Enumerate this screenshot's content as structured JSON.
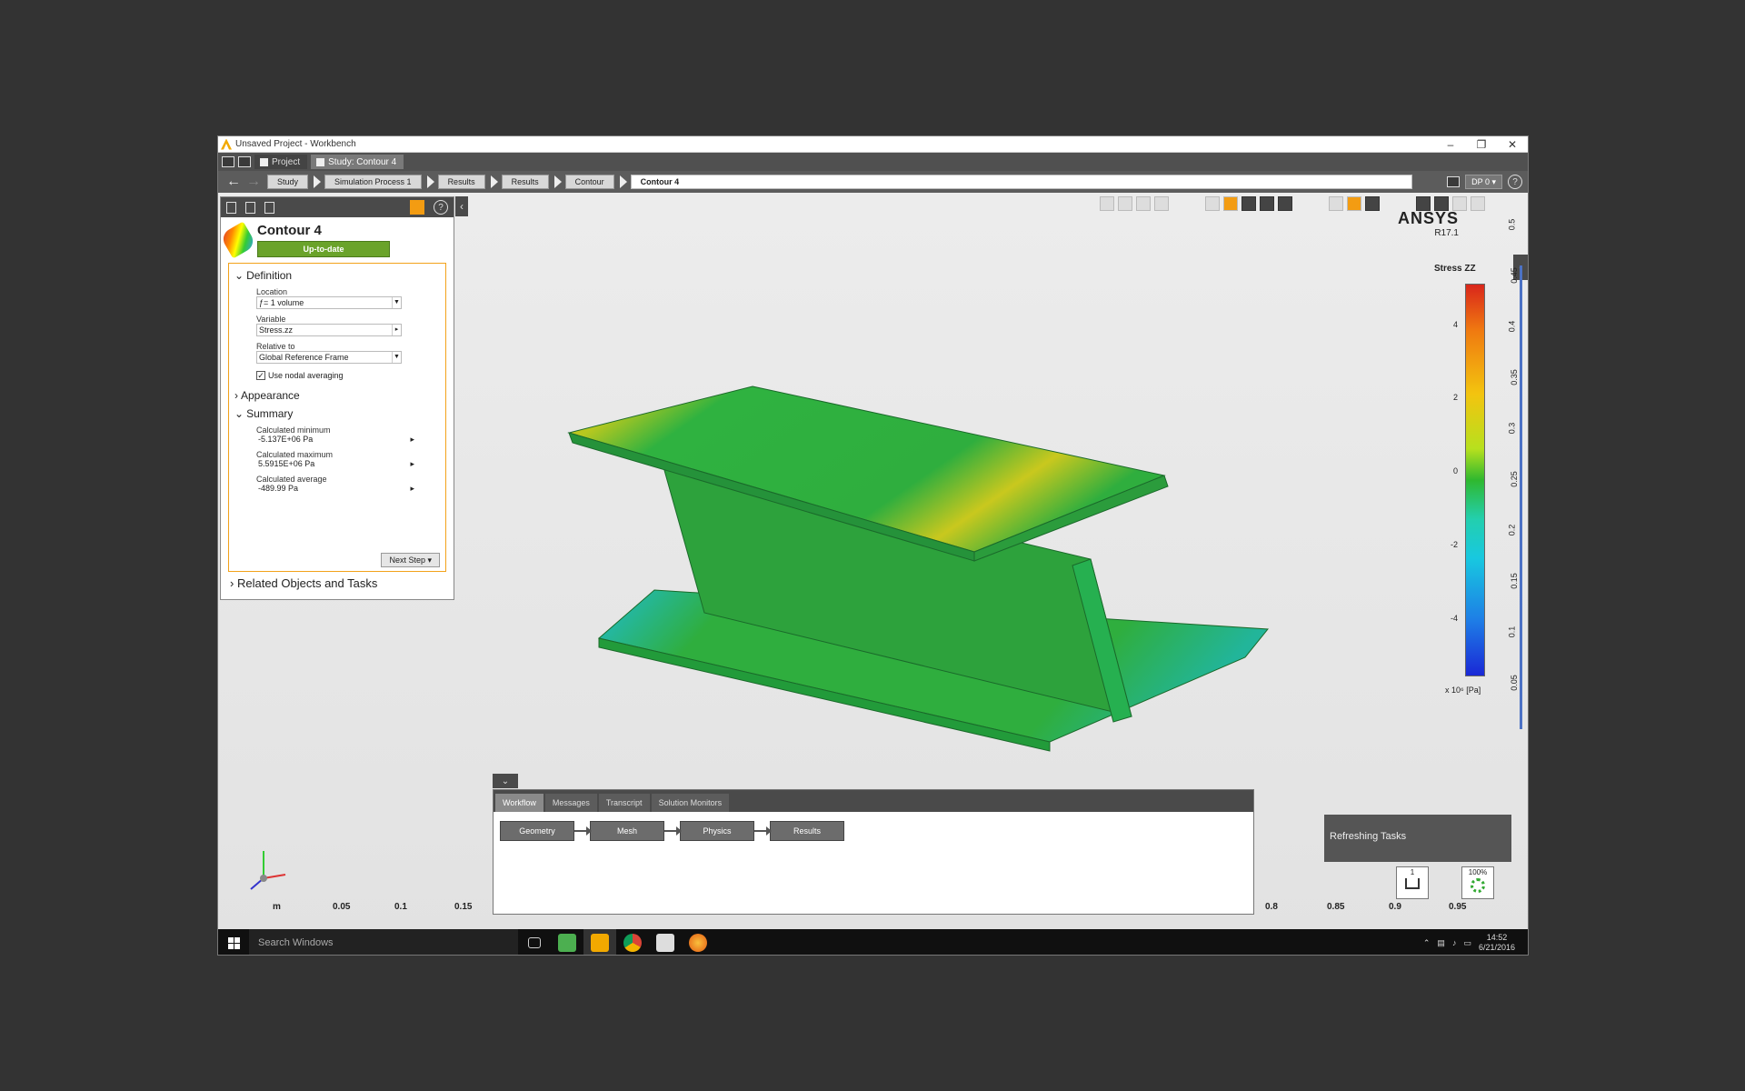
{
  "window": {
    "title": "Unsaved Project - Workbench",
    "controls": [
      "–",
      "❐",
      "✕"
    ]
  },
  "tabs": [
    {
      "label": "Project"
    },
    {
      "label": "Study: Contour 4"
    }
  ],
  "breadcrumb": [
    "Study",
    "Simulation Process 1",
    "Results",
    "Results",
    "Contour",
    "Contour 4"
  ],
  "nav_right": {
    "dp": "DP 0 ▾",
    "help": "?"
  },
  "panel": {
    "title": "Contour 4",
    "status": "Up-to-date",
    "definition": {
      "header": "Definition",
      "location_label": "Location",
      "location_value": "ƒ= 1 volume",
      "variable_label": "Variable",
      "variable_value": "Stress.zz",
      "relative_label": "Relative to",
      "relative_value": "Global Reference Frame",
      "nodal_averaging": "Use nodal averaging"
    },
    "appearance_header": "Appearance",
    "summary": {
      "header": "Summary",
      "min_label": "Calculated minimum",
      "min_value": "-5.137E+06 Pa",
      "max_label": "Calculated maximum",
      "max_value": "5.5915E+06 Pa",
      "avg_label": "Calculated average",
      "avg_value": "-489.99 Pa"
    },
    "next_step": "Next Step ▾",
    "related": "Related Objects and Tasks"
  },
  "brand": {
    "name": "ANSYS",
    "version": "R17.1"
  },
  "legend": {
    "title": "Stress ZZ",
    "ticks": [
      "4",
      "2",
      "0",
      "-2",
      "-4"
    ],
    "unit": "x 10⁶ [Pa]"
  },
  "side_ruler": [
    "0.5",
    "0.45",
    "0.4",
    "0.35",
    "0.3",
    "0.25",
    "0.2",
    "0.15",
    "0.1",
    "0.05"
  ],
  "bottom_ruler": [
    "m",
    "0.05",
    "0.1",
    "0.15",
    "0.8",
    "0.85",
    "0.9",
    "0.95"
  ],
  "message_panel": {
    "tabs": [
      "Workflow",
      "Messages",
      "Transcript",
      "Solution Monitors"
    ],
    "steps": [
      "Geometry",
      "Mesh",
      "Physics",
      "Results"
    ]
  },
  "refreshing": "Refreshing Tasks",
  "counters": {
    "tasks": "1",
    "progress": "100%"
  },
  "taskbar": {
    "search": "Search Windows",
    "time": "14:52",
    "date": "6/21/2016"
  },
  "colors": {
    "status_green": "#6aa32a",
    "accent_orange": "#f39c12"
  }
}
